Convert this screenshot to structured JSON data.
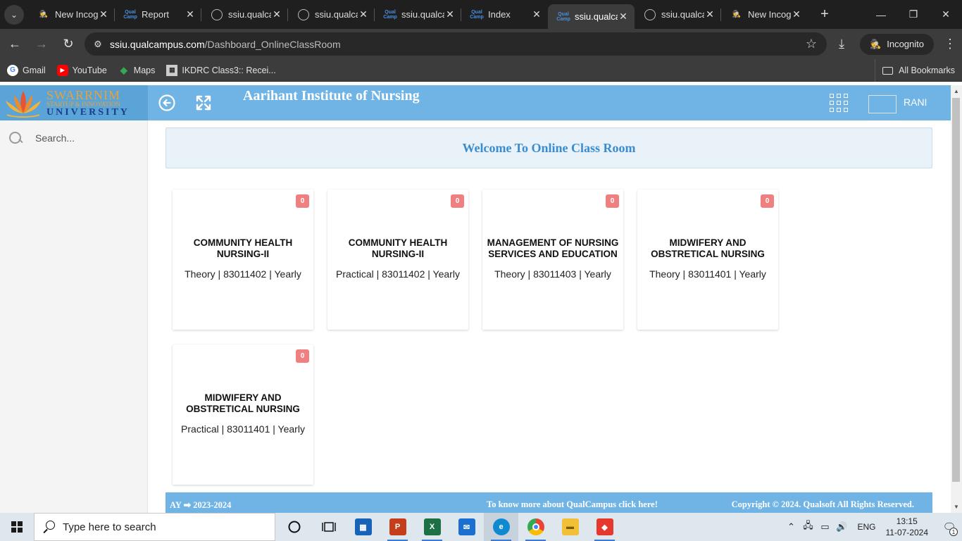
{
  "browser": {
    "tabs": [
      {
        "icon": "incognito-icon",
        "title": "New Incognito Tab"
      },
      {
        "icon": "qualcampus-icon",
        "title": "Report"
      },
      {
        "icon": "globe-icon",
        "title": "ssiu.qualcampus.com"
      },
      {
        "icon": "globe-icon",
        "title": "ssiu.qualcampus.com"
      },
      {
        "icon": "qualcampus-icon",
        "title": "ssiu.qualcampus.com"
      },
      {
        "icon": "qualcampus-icon",
        "title": "Index"
      },
      {
        "icon": "qualcampus-icon",
        "title": "ssiu.qualcampus.com",
        "active": true
      },
      {
        "icon": "globe-icon",
        "title": "ssiu.qualcampus.com"
      },
      {
        "icon": "incognito-icon",
        "title": "New Incognito Tab"
      }
    ],
    "url_host": "ssiu.qualcampus.com",
    "url_path": "/Dashboard_OnlineClassRoom",
    "incognito_label": "Incognito",
    "bookmarks": [
      {
        "icon": "google-icon",
        "label": "Gmail"
      },
      {
        "icon": "youtube-icon",
        "label": "YouTube"
      },
      {
        "icon": "maps-icon",
        "label": "Maps"
      },
      {
        "icon": "ikdrc-icon",
        "label": "IKDRC Class3:: Recei..."
      }
    ],
    "all_bookmarks_label": "All Bookmarks"
  },
  "header": {
    "logo": {
      "line1": "SWARRNIM",
      "line2": "STARTUP & INNOVATION",
      "line3": "UNIVERSITY"
    },
    "institute_name": "Aarihant Institute of Nursing",
    "user_name": "RANI"
  },
  "sidebar": {
    "search_placeholder": "Search..."
  },
  "main": {
    "welcome_title": "Welcome To Online Class Room",
    "courses": [
      {
        "badge": "0",
        "title": "COMMUNITY HEALTH NURSING-II",
        "subtitle": "Theory | 83011402 | Yearly"
      },
      {
        "badge": "0",
        "title": "COMMUNITY HEALTH NURSING-II",
        "subtitle": "Practical | 83011402 | Yearly"
      },
      {
        "badge": "0",
        "title": "MANAGEMENT OF NURSING SERVICES AND EDUCATION",
        "subtitle": "Theory | 83011403 | Yearly"
      },
      {
        "badge": "0",
        "title": "MIDWIFERY AND OBSTRETICAL NURSING",
        "subtitle": "Theory | 83011401 | Yearly"
      },
      {
        "badge": "0",
        "title": "MIDWIFERY AND OBSTRETICAL NURSING",
        "subtitle": "Practical | 83011401 | Yearly"
      }
    ]
  },
  "footer": {
    "ay_label": "AY",
    "ay_value": "2023-2024",
    "know_more": "To know more about QualCampus click here!",
    "copyright": "Copyright © 2024. Qualsoft All Rights Reserved."
  },
  "taskbar": {
    "search_placeholder": "Type here to search",
    "language": "ENG",
    "time": "13:15",
    "date": "11-07-2024",
    "notification_count": "1"
  },
  "colors": {
    "header_blue": "#6fb4e4",
    "welcome_text": "#3a8ccf",
    "badge": "#f08080"
  }
}
